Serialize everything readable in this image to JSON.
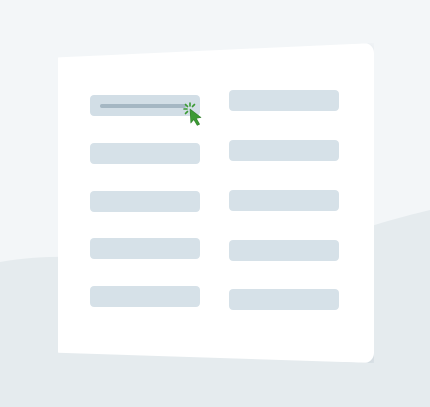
{
  "illustration": {
    "background_color": "#f3f6f8",
    "background_shape_color": "#e5ebee",
    "card_color": "#ffffff",
    "field_color": "#d6e1e8",
    "field_fill_indicator_color": "#a5b7c3",
    "cursor_color": "#3b9a34",
    "cursor_icon": "click-arrow-icon",
    "form": {
      "columns": 2,
      "rows": 5,
      "selected_field": "row 1, column 1"
    }
  }
}
